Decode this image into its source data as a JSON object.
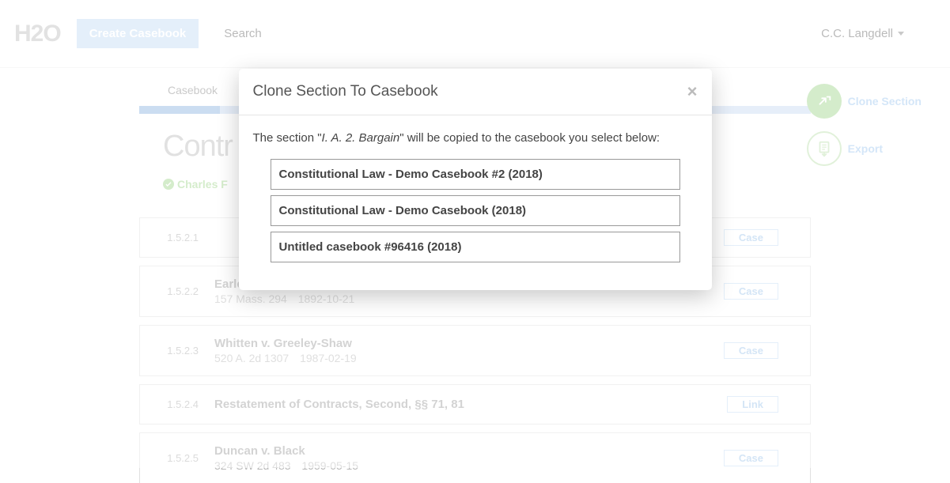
{
  "header": {
    "logo": "H2O",
    "create_label": "Create Casebook",
    "search_label": "Search",
    "user_name": "C.C. Langdell"
  },
  "tabs": {
    "casebook": "Casebook"
  },
  "page": {
    "title": "Contr",
    "author": "Charles F"
  },
  "actions": {
    "clone_label": "Clone Section",
    "export_label": "Export"
  },
  "items": [
    {
      "num": "1.5.2.1",
      "title": "",
      "cite": "",
      "date": "",
      "badge": "Case"
    },
    {
      "num": "1.5.2.2",
      "title": "Earle v. Angell",
      "cite": "157 Mass. 294",
      "date": "1892-10-21",
      "badge": "Case"
    },
    {
      "num": "1.5.2.3",
      "title": "Whitten v. Greeley-Shaw",
      "cite": "520 A. 2d 1307",
      "date": "1987-02-19",
      "badge": "Case"
    },
    {
      "num": "1.5.2.4",
      "title": "Restatement of Contracts, Second, §§ 71, 81",
      "cite": "",
      "date": "",
      "badge": "Link"
    },
    {
      "num": "1.5.2.5",
      "title": "Duncan v. Black",
      "cite": "324 SW 2d 483",
      "date": "1959-05-15",
      "badge": "Case"
    }
  ],
  "modal": {
    "title": "Clone Section To Casebook",
    "text_prefix": "The section \"",
    "section_name": "I. A. 2. Bargain",
    "text_suffix": "\" will be copied to the casebook you select below:",
    "options": [
      "Constitutional Law - Demo Casebook #2 (2018)",
      "Constitutional Law - Demo Casebook (2018)",
      "Untitled casebook #96416 (2018)"
    ]
  }
}
